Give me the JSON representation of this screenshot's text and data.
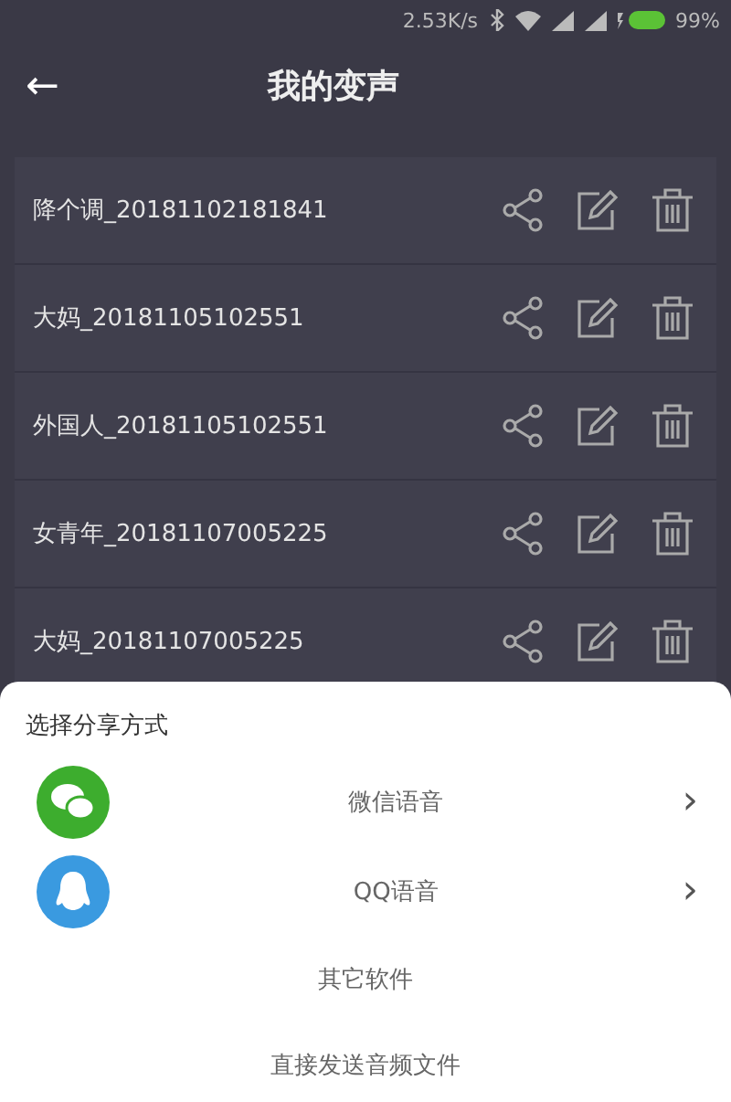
{
  "status_bar": {
    "speed": "2.53K/s",
    "battery": "99%"
  },
  "header": {
    "back": "←",
    "title": "我的变声"
  },
  "recordings": [
    {
      "name": "降个调_20181102181841"
    },
    {
      "name": "大妈_20181105102551"
    },
    {
      "name": "外国人_20181105102551"
    },
    {
      "name": "女青年_20181107005225"
    },
    {
      "name": "大妈_20181107005225"
    }
  ],
  "share_sheet": {
    "title": "选择分享方式",
    "options": [
      {
        "kind": "wechat",
        "label": "微信语音",
        "chevron": "›"
      },
      {
        "kind": "qq",
        "label": "QQ语音",
        "chevron": "›"
      },
      {
        "kind": "plain",
        "label": "其它软件"
      },
      {
        "kind": "plain",
        "label": "直接发送音频文件"
      }
    ]
  }
}
